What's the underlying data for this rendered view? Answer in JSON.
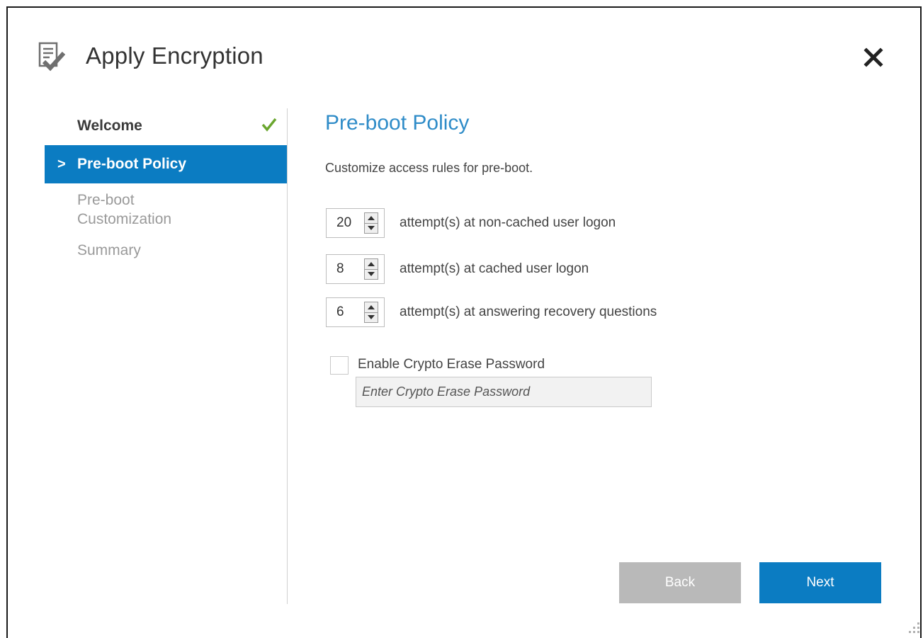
{
  "window": {
    "title": "Apply Encryption",
    "title_icon": "checklist-icon",
    "close_icon": "close-icon"
  },
  "nav": {
    "items": [
      {
        "label": "Welcome",
        "state": "completed"
      },
      {
        "label": "Pre-boot Policy",
        "state": "active"
      },
      {
        "label": "Pre-boot Customization",
        "line1": "Pre-boot",
        "line2": "Customization",
        "state": "pending"
      },
      {
        "label": "Summary",
        "state": "pending"
      }
    ],
    "active_marker": ">"
  },
  "main": {
    "title": "Pre-boot Policy",
    "description": "Customize access rules for pre-boot.",
    "steppers": [
      {
        "value": "20",
        "label": "attempt(s) at non-cached user logon"
      },
      {
        "value": "8",
        "label": "attempt(s) at cached user logon"
      },
      {
        "value": "6",
        "label": "attempt(s) at answering recovery questions"
      }
    ],
    "crypto_erase": {
      "checkbox_label": "Enable Crypto Erase Password",
      "checked": false,
      "input_value": "",
      "input_placeholder": "Enter Crypto Erase Password"
    }
  },
  "footer": {
    "back_label": "Back",
    "next_label": "Next"
  },
  "colors": {
    "accent": "#0b7cc2",
    "title_blue": "#2f8cc8",
    "check_green": "#6aa62e",
    "disabled_button": "#b9b9b9"
  }
}
